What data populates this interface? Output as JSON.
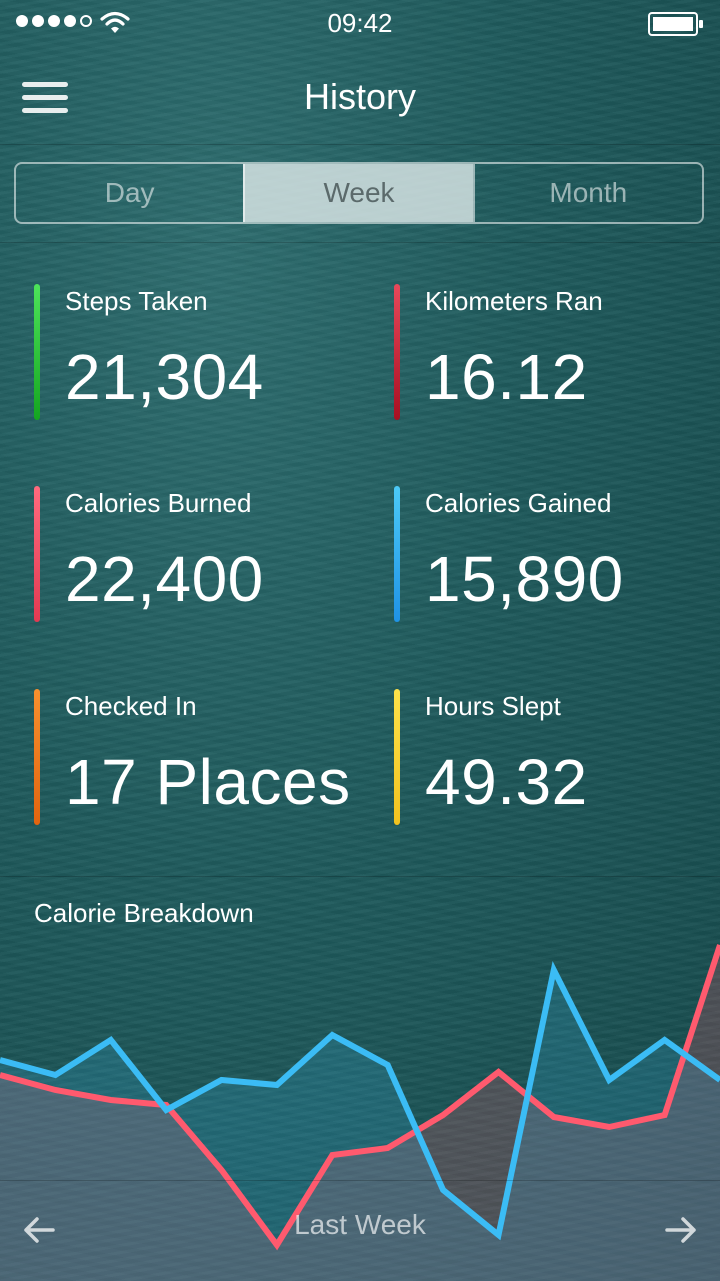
{
  "status": {
    "time": "09:42"
  },
  "nav": {
    "title": "History"
  },
  "tabs": [
    {
      "label": "Day"
    },
    {
      "label": "Week"
    },
    {
      "label": "Month"
    }
  ],
  "active_tab": "Week",
  "stats": [
    {
      "label": "Steps Taken",
      "value": "21,304",
      "color": "#22c22e"
    },
    {
      "label": "Kilometers Ran",
      "value": "16.12",
      "color": "#d42a3c"
    },
    {
      "label": "Calories Burned",
      "value": "22,400",
      "color": "#f0526a"
    },
    {
      "label": "Calories Gained",
      "value": "15,890",
      "color": "#37b7f0"
    },
    {
      "label": "Checked In",
      "value": "17 Places",
      "color": "#f0781e"
    },
    {
      "label": "Hours Slept",
      "value": "49.32",
      "color": "#f7d635"
    }
  ],
  "chart": {
    "title": "Calorie Breakdown"
  },
  "chart_data": {
    "type": "line",
    "x": [
      0,
      1,
      2,
      3,
      4,
      5,
      6,
      7,
      8,
      9,
      10,
      11,
      12,
      13
    ],
    "series": [
      {
        "values": [
          45,
          30,
          20,
          15,
          -50,
          -125,
          -35,
          -28,
          5,
          48,
          3,
          -7,
          5,
          175
        ],
        "color": "#ff5a6e"
      },
      {
        "values": [
          60,
          45,
          80,
          10,
          40,
          35,
          85,
          55,
          -70,
          -115,
          150,
          40,
          80,
          40
        ],
        "color": "#3bbcf5"
      }
    ],
    "ylim": [
      -150,
      200
    ]
  },
  "footer": {
    "label": "Last Week"
  }
}
